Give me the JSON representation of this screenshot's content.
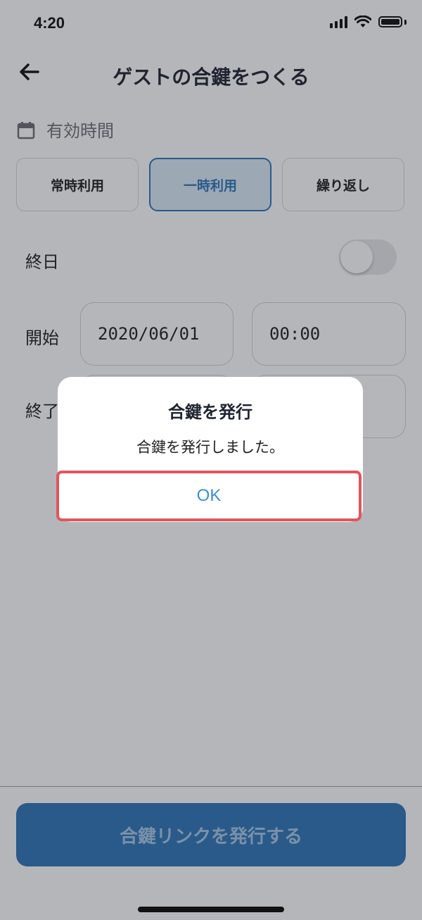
{
  "status_bar": {
    "time": "4:20"
  },
  "header": {
    "title": "ゲストの合鍵をつくる"
  },
  "section": {
    "label": "有効時間"
  },
  "segments": [
    {
      "label": "常時利用",
      "active": false
    },
    {
      "label": "一時利用",
      "active": true
    },
    {
      "label": "繰り返し",
      "active": false
    }
  ],
  "all_day": {
    "label": "終日",
    "on": false
  },
  "start": {
    "label": "開始",
    "date": "2020/06/01",
    "time": "00:00"
  },
  "end": {
    "label": "終了"
  },
  "bottom_button": {
    "label": "合鍵リンクを発行する"
  },
  "dialog": {
    "title": "合鍵を発行",
    "message": "合鍵を発行しました。",
    "ok_label": "OK"
  },
  "colors": {
    "accent": "#2f77b8",
    "highlight": "#e4545c",
    "link": "#3a8fd6"
  }
}
